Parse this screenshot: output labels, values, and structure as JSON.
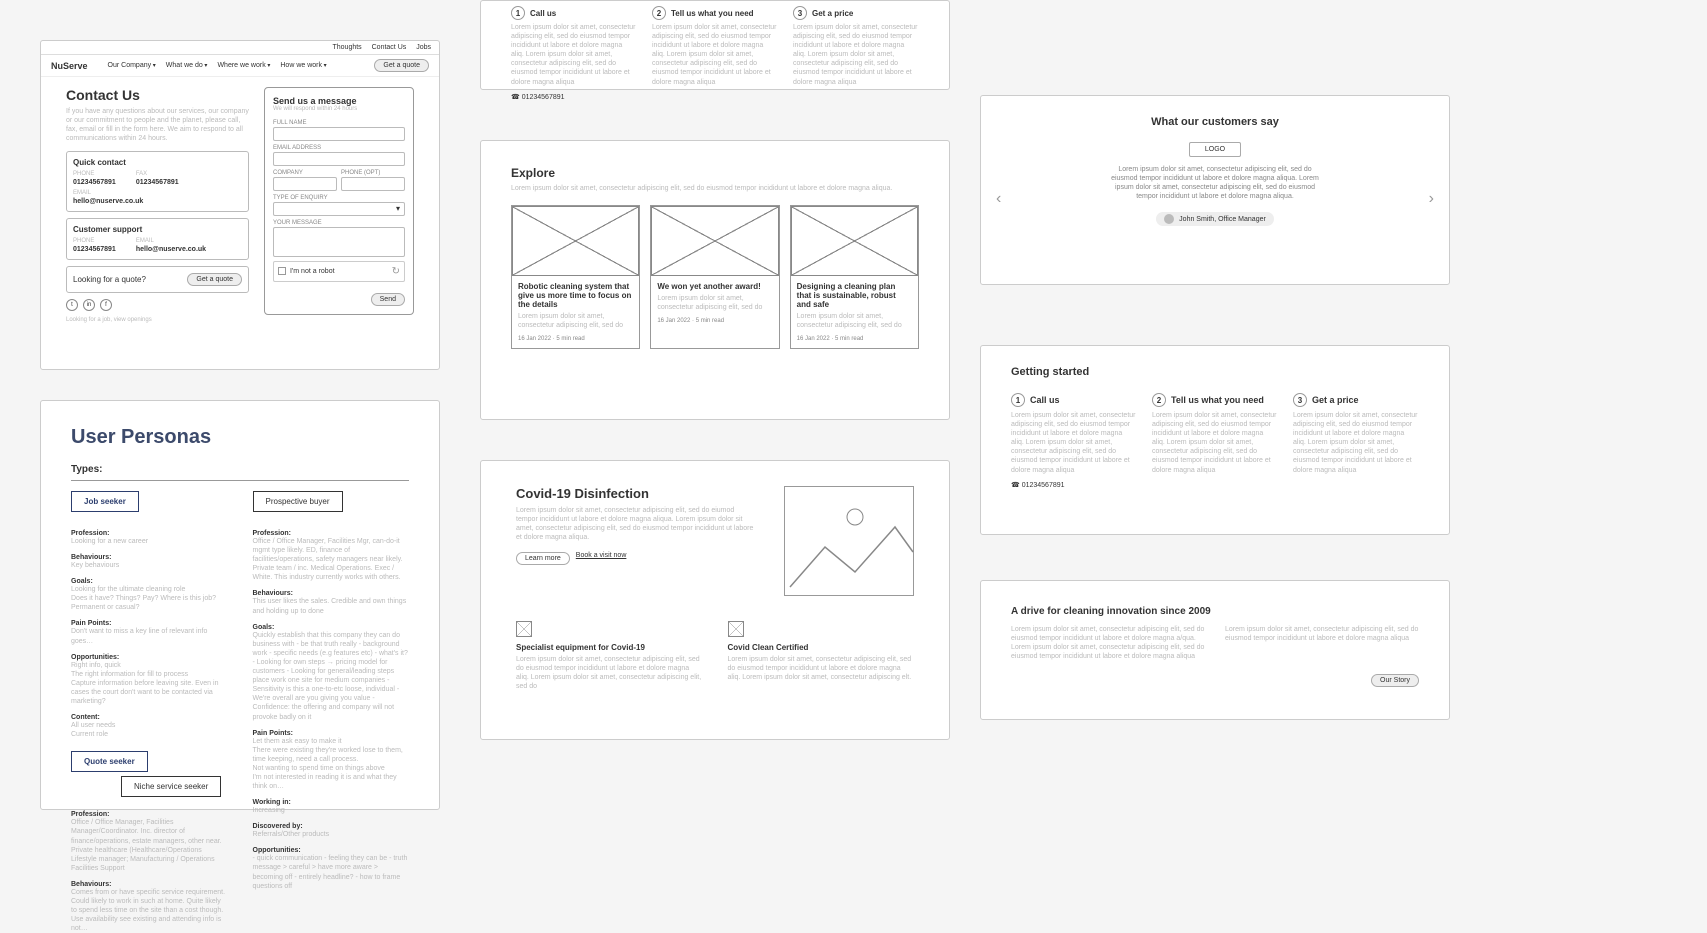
{
  "p1": {
    "topbar": [
      "Thoughts",
      "Contact Us",
      "Jobs"
    ],
    "logo": "NuServe",
    "nav": [
      "Our Company",
      "What we do",
      "Where we work",
      "How we work"
    ],
    "quote_btn": "Get a quote",
    "h1": "Contact Us",
    "intro": "If you have any questions about our services, our company or our commitment to people and the planet, please call, fax, email or fill in the form here. We aim to respond to all communications within 24 hours.",
    "quick_contact_title": "Quick contact",
    "phone_label": "PHONE",
    "phone": "01234567891",
    "fax_label": "FAX",
    "fax": "01234567891",
    "email_label": "EMAIL",
    "email": "hello@nuserve.co.uk",
    "support_title": "Customer support",
    "looking_quote": "Looking for a quote?",
    "get_quote_btn": "Get a quote",
    "job_links": "Looking for a job, view openings",
    "form_title": "Send us a message",
    "form_sub": "We will respond within 24 hours",
    "f_name": "FULL NAME",
    "f_email": "EMAIL ADDRESS",
    "f_company": "COMPANY",
    "f_phone": "PHONE (OPT)",
    "f_enquiry": "TYPE OF ENQUIRY",
    "f_message": "YOUR MESSAGE",
    "f_robot": "I'm not a robot",
    "f_send": "Send"
  },
  "p2": {
    "h1": "User Personas",
    "types_label": "Types:",
    "type1": "Job seeker",
    "type2": "Prospective buyer",
    "type3": "Quote seeker",
    "type4": "Niche service seeker",
    "col1": {
      "profession": "Profession:",
      "profession_v": "Looking for a new career",
      "behaviours": "Behaviours:",
      "behaviours_v": "Key behaviours",
      "goals": "Goals:",
      "goals_v": "Looking for the ultimate cleaning role",
      "goals_q": "Does it have? Things? Pay? Where is this job? Permanent or casual?",
      "pain": "Pain Points:",
      "pain_v": "Don't want to miss a key line of relevant info goes…",
      "opp": "Opportunities:",
      "opp_v": "Right info, quick",
      "opp_v2": "The right information for fill to process",
      "opp_v3": "Capture information before leaving site. Even in cases the court don't want to be contacted via marketing?",
      "content": "Content:",
      "content_v": "All user needs",
      "content_v2": "Current role"
    },
    "col2": {
      "profession": "Profession:",
      "profession_v": "Office / Office Manager, Facilities Mgr, can-do-it mgmt type likely. ED, finance of facilities/operations, safety managers near likely. Private team / inc. Medical Operations. Exec / White. This industry currently works with others.",
      "behaviours": "Behaviours:",
      "behaviours_v": "This user likes the sales. Credible and own things and holding up to done",
      "goals": "Goals:",
      "goals_v": "Quickly establish that this company they can do business with - be that truth really - background work - specific needs (e.g features etc) - what's it? - Looking for own steps → pricing model for customers - Looking for general/leading steps place work one site for medium companies - Sensitivity is this a one-to-etc loose, individual - We're overall are you giving you value - Confidence: the offering and company will not provoke badly on it",
      "pain": "Pain Points:",
      "pain_v": "Let them ask easy to make it",
      "pain_v2": "There were existing they're worked lose to them, time keeping, need a call process.",
      "pain_v3": "Not wanting to spend time on things above",
      "pain_v4": "I'm not interested in reading it is and what they think on…",
      "working": "Working in:",
      "working_v": "Increasing",
      "discover": "Discovered by:",
      "discover_v": "Referrals/Other products",
      "opp": "Opportunities:",
      "opp_v": "- quick communication - feeling they can be - truth message > careful > have more aware > becoming off - entirely headline? - how to frame questions off"
    },
    "col1b": {
      "profession": "Profession:",
      "profession_v": "Office / Office Manager, Facilities Manager/Coordinator. Inc. director of finance/operations, estate managers, other near. Private healthcare (Healthcare/Operations Lifestyle manager; Manufacturing / Operations Facilities Support",
      "behaviours": "Behaviours:",
      "behaviours_v": "Comes from or have specific service requirement. Could likely to work in such at home. Quite likely to spend less time on the site than a cost though. Use availability see existing and attending info is not…"
    }
  },
  "steps": {
    "s1": "Call us",
    "s2": "Tell us what you need",
    "s3": "Get a price",
    "body": "Lorem ipsum dolor sit amet, consectetur adipiscing elit, sed do eiusmod tempor incididunt ut labore et dolore magna aliq. Lorem ipsum dolor sit amet, consectetur adipiscing elit, sed do eiusmod tempor incididunt ut labore et dolore magna aliqua",
    "phone": "01234567891"
  },
  "p4": {
    "h2": "Explore",
    "sub": "Lorem ipsum dolor sit amet, consectetur adipiscing elit, sed do eiusmod tempor incididunt ut labore et dolore magna aliqua.",
    "cards": [
      {
        "title": "Robotic cleaning system that give us more time to focus on the details",
        "body": "Lorem ipsum dolor sit amet, consectetur adipiscing elit, sed do",
        "date": "16 Jan 2022",
        "read": "5 min read"
      },
      {
        "title": "We won yet another award!",
        "body": "Lorem ipsum dolor sit amet, consectetur adipiscing elit, sed do",
        "date": "16 Jan 2022",
        "read": "5 min read"
      },
      {
        "title": "Designing a cleaning plan that is sustainable, robust and safe",
        "body": "Lorem ipsum dolor sit amet, consectetur adipiscing elit, sed do",
        "date": "16 Jan 2022",
        "read": "5 min read"
      }
    ]
  },
  "p5": {
    "h2": "Covid-19 Disinfection",
    "body": "Lorem ipsum dolor sit amet, consectetur adipiscing elit, sed do eiumod tempor incididunt ut labore et dolore magna aliqua. Lorem ipsum dolor sit amet, consectetur adipiscing elit, sed do eiusmod tempor incididunt ut labore et dolore magna aliqua.",
    "btn1": "Learn more",
    "btn2": "Book a visit now",
    "item1_title": "Specialist equipment for Covid-19",
    "item1_body": "Lorem ipsum dolor sit amet, consectetur adipiscing elit, sed do eiusmod tempor incididunt ut labore et dolore magna aliq. Lorem ipsum dolor sit amet, consectetur adipiscing elit, sed do",
    "item2_title": "Covid Clean Certified",
    "item2_body": "Lorem ipsum dolor sit amet, consectetur adipiscing elit, sed do eiusmod tempor incididunt ut labore et dolore magna aliq. Lorem ipsum dolor sit amet, consectetur adipiscing elt."
  },
  "p6": {
    "h3": "What our customers say",
    "logo": "LOGO",
    "quote": "Lorem ipsum dolor sit amet, consectetur adipiscing elit, sed do eiusmod tempor incididunt ut labore et dolore magna aliqua. Lorem ipsum dolor sit amet, consectetur adipiscing elit, sed do eiusmod tempor incididunt ut labore et dolore magna aliqua.",
    "author": "John Smith, Office Manager"
  },
  "p7": {
    "h3": "Getting started"
  },
  "p8": {
    "h3": "A drive for cleaning innovation since 2009",
    "c1": "Lorem ipsum dolor sit amet, consectetur adipiscing elit, sed do eiusmod tempor incididunt ut labore et dolore magna a/qua. Lorem ipsum dolor sit amet, consectetur adipiscing elit, sed do eiusmod tempor incididunt ut labore et dolore magna aliqua",
    "c2": "Lorem ipsum dolor sit amet, consectetur adipiscing elit, sed do eiusmod tempor incididunt ut labore et dolore magna aliqua",
    "btn": "Our Story"
  }
}
